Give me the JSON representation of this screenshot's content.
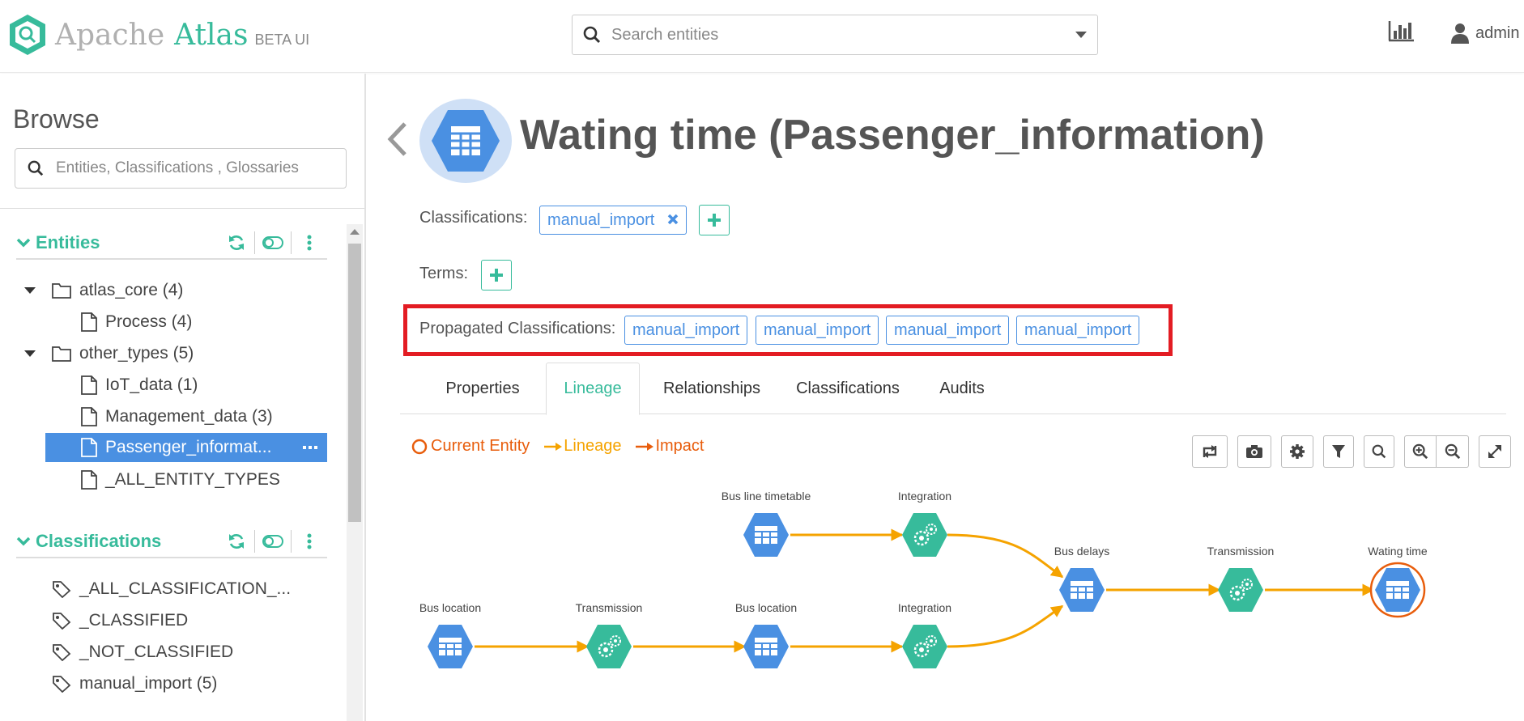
{
  "header": {
    "logo_apache": "Apache",
    "logo_atlas": "Atlas",
    "logo_beta": "BETA UI",
    "search_placeholder": "Search entities",
    "user_name": "admin"
  },
  "sidebar": {
    "title": "Browse",
    "search_placeholder": "Entities, Classifications , Glossaries",
    "entities_title": "Entities",
    "entity_tree": [
      "atlas_core (4)",
      "Process (4)",
      "other_types (5)",
      "IoT_data (1)",
      "Management_data (3)",
      "Passenger_informat...",
      "_ALL_ENTITY_TYPES"
    ],
    "classifications_title": "Classifications",
    "classification_list": [
      "_ALL_CLASSIFICATION_...",
      "_CLASSIFIED",
      "_NOT_CLASSIFIED",
      "manual_import (5)"
    ]
  },
  "entity": {
    "title": "Wating time (Passenger_information)",
    "classifications_label": "Classifications:",
    "classification_tag": "manual_import",
    "terms_label": "Terms:",
    "propagated_label": "Propagated Classifications:",
    "propagated_tags": [
      "manual_import",
      "manual_import",
      "manual_import",
      "manual_import"
    ]
  },
  "tabs": [
    "Properties",
    "Lineage",
    "Relationships",
    "Classifications",
    "Audits"
  ],
  "active_tab": "Lineage",
  "legend": {
    "current": "Current Entity",
    "lineage": "Lineage",
    "impact": "Impact"
  },
  "lineage_nodes": [
    "Bus line timetable",
    "Integration",
    "Bus delays",
    "Transmission",
    "Wating time",
    "Bus location",
    "Transmission",
    "Bus location",
    "Integration"
  ],
  "colors": {
    "accent": "#37bb9b",
    "primary": "#4a90e2",
    "lineage": "#f5a300",
    "impact": "#e85d0c",
    "highlight": "#e31c23"
  }
}
